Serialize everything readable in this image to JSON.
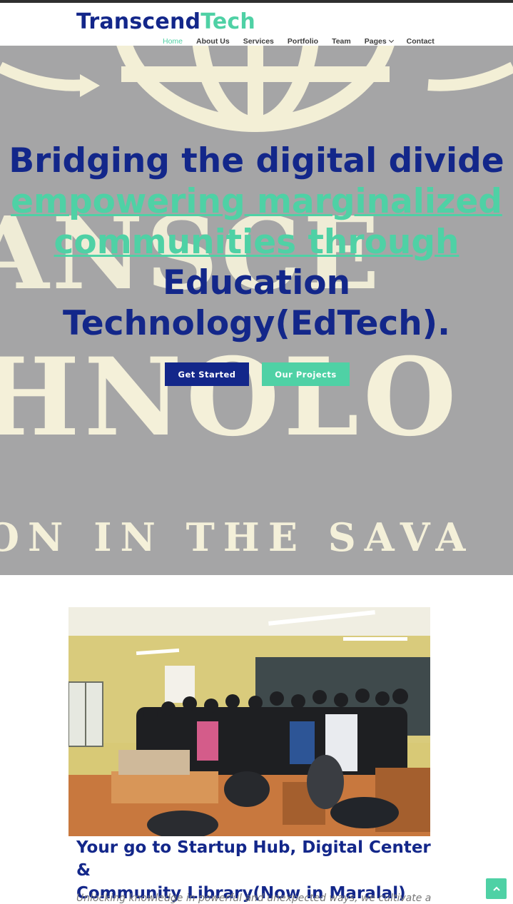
{
  "brand": {
    "part1": "Transcend",
    "part2": "Tech"
  },
  "nav": {
    "items": [
      {
        "label": "Home",
        "active": true
      },
      {
        "label": "About Us"
      },
      {
        "label": "Services"
      },
      {
        "label": "Portfolio"
      },
      {
        "label": "Team"
      },
      {
        "label": "Pages",
        "has_dropdown": true
      },
      {
        "label": "Contact"
      }
    ]
  },
  "hero": {
    "line1": "Bridging the digital divide",
    "line2a": "empowering marginalized",
    "line2b": "communities through",
    "line3a": "Education",
    "line3b": "Technology(EdTech).",
    "background_text": {
      "row1": "ANSCE",
      "row2": "HNOLO",
      "row3": "ON IN THE SAVA"
    },
    "buttons": {
      "primary": "Get Started",
      "secondary": "Our Projects"
    }
  },
  "section": {
    "title_line1": "Your go to Startup Hub, Digital Center &",
    "title_line2": "Community Library(Now in Maralal)",
    "subtitle": "Unlocking knowledge in powerful and unexpected ways, we cultivate a"
  },
  "colors": {
    "navy": "#13278a",
    "mint": "#4fd1a5",
    "hero_bg": "#a5a5a6"
  },
  "icons": {
    "back_to_top": "arrow-up-icon",
    "dropdown": "chevron-down-icon"
  }
}
